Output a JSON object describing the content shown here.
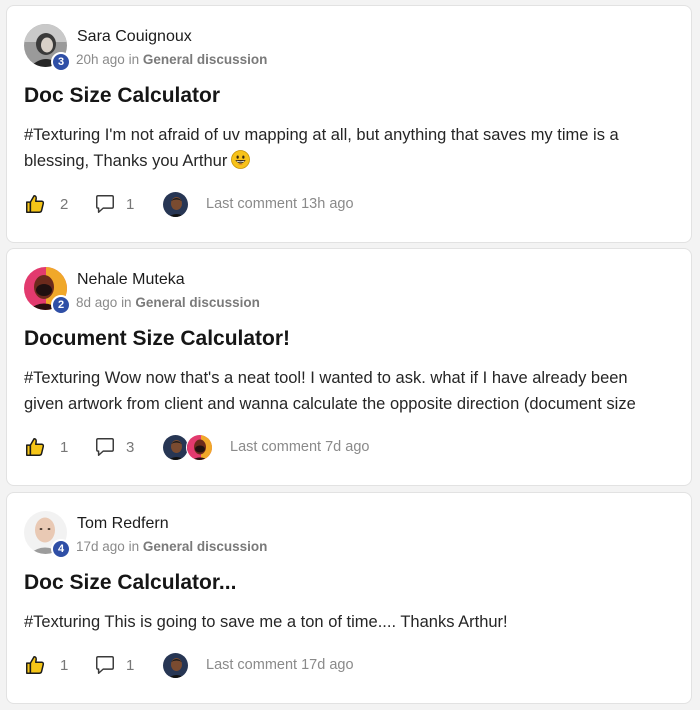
{
  "posts": [
    {
      "author": "Sara Couignoux",
      "level": "3",
      "time": "20h ago",
      "in_label": "in",
      "category": "General discussion",
      "title": "Doc Size Calculator",
      "body_lines": [
        "#Texturing I'm not afraid of uv mapping at all, but anything that saves my time is a",
        "blessing, Thanks you Arthur"
      ],
      "emoji": "grinning-face",
      "likes": "2",
      "comments": "1",
      "commenter_count": 1,
      "last_comment": "Last comment 13h ago"
    },
    {
      "author": "Nehale Muteka",
      "level": "2",
      "time": "8d ago",
      "in_label": "in",
      "category": "General discussion",
      "title": "Document Size Calculator!",
      "body_lines": [
        "#Texturing Wow now that's a neat tool! I wanted to ask. what if I have already been",
        "given artwork from client and wanna calculate the opposite direction (document size"
      ],
      "likes": "1",
      "comments": "3",
      "commenter_count": 2,
      "last_comment": "Last comment 7d ago"
    },
    {
      "author": "Tom Redfern",
      "level": "4",
      "time": "17d ago",
      "in_label": "in",
      "category": "General discussion",
      "title": "Doc Size Calculator...",
      "body_lines": [
        "#Texturing This is going to save me a ton of time.... Thanks Arthur!"
      ],
      "likes": "1",
      "comments": "1",
      "commenter_count": 1,
      "last_comment": "Last comment 17d ago"
    }
  ],
  "icons": {
    "like": "thumbs-up-icon",
    "comment": "speech-bubble-icon"
  },
  "colors": {
    "level_badge": "#2f4fa6",
    "like_fill": "#f5c518",
    "meta_text": "#8a8a8a"
  }
}
